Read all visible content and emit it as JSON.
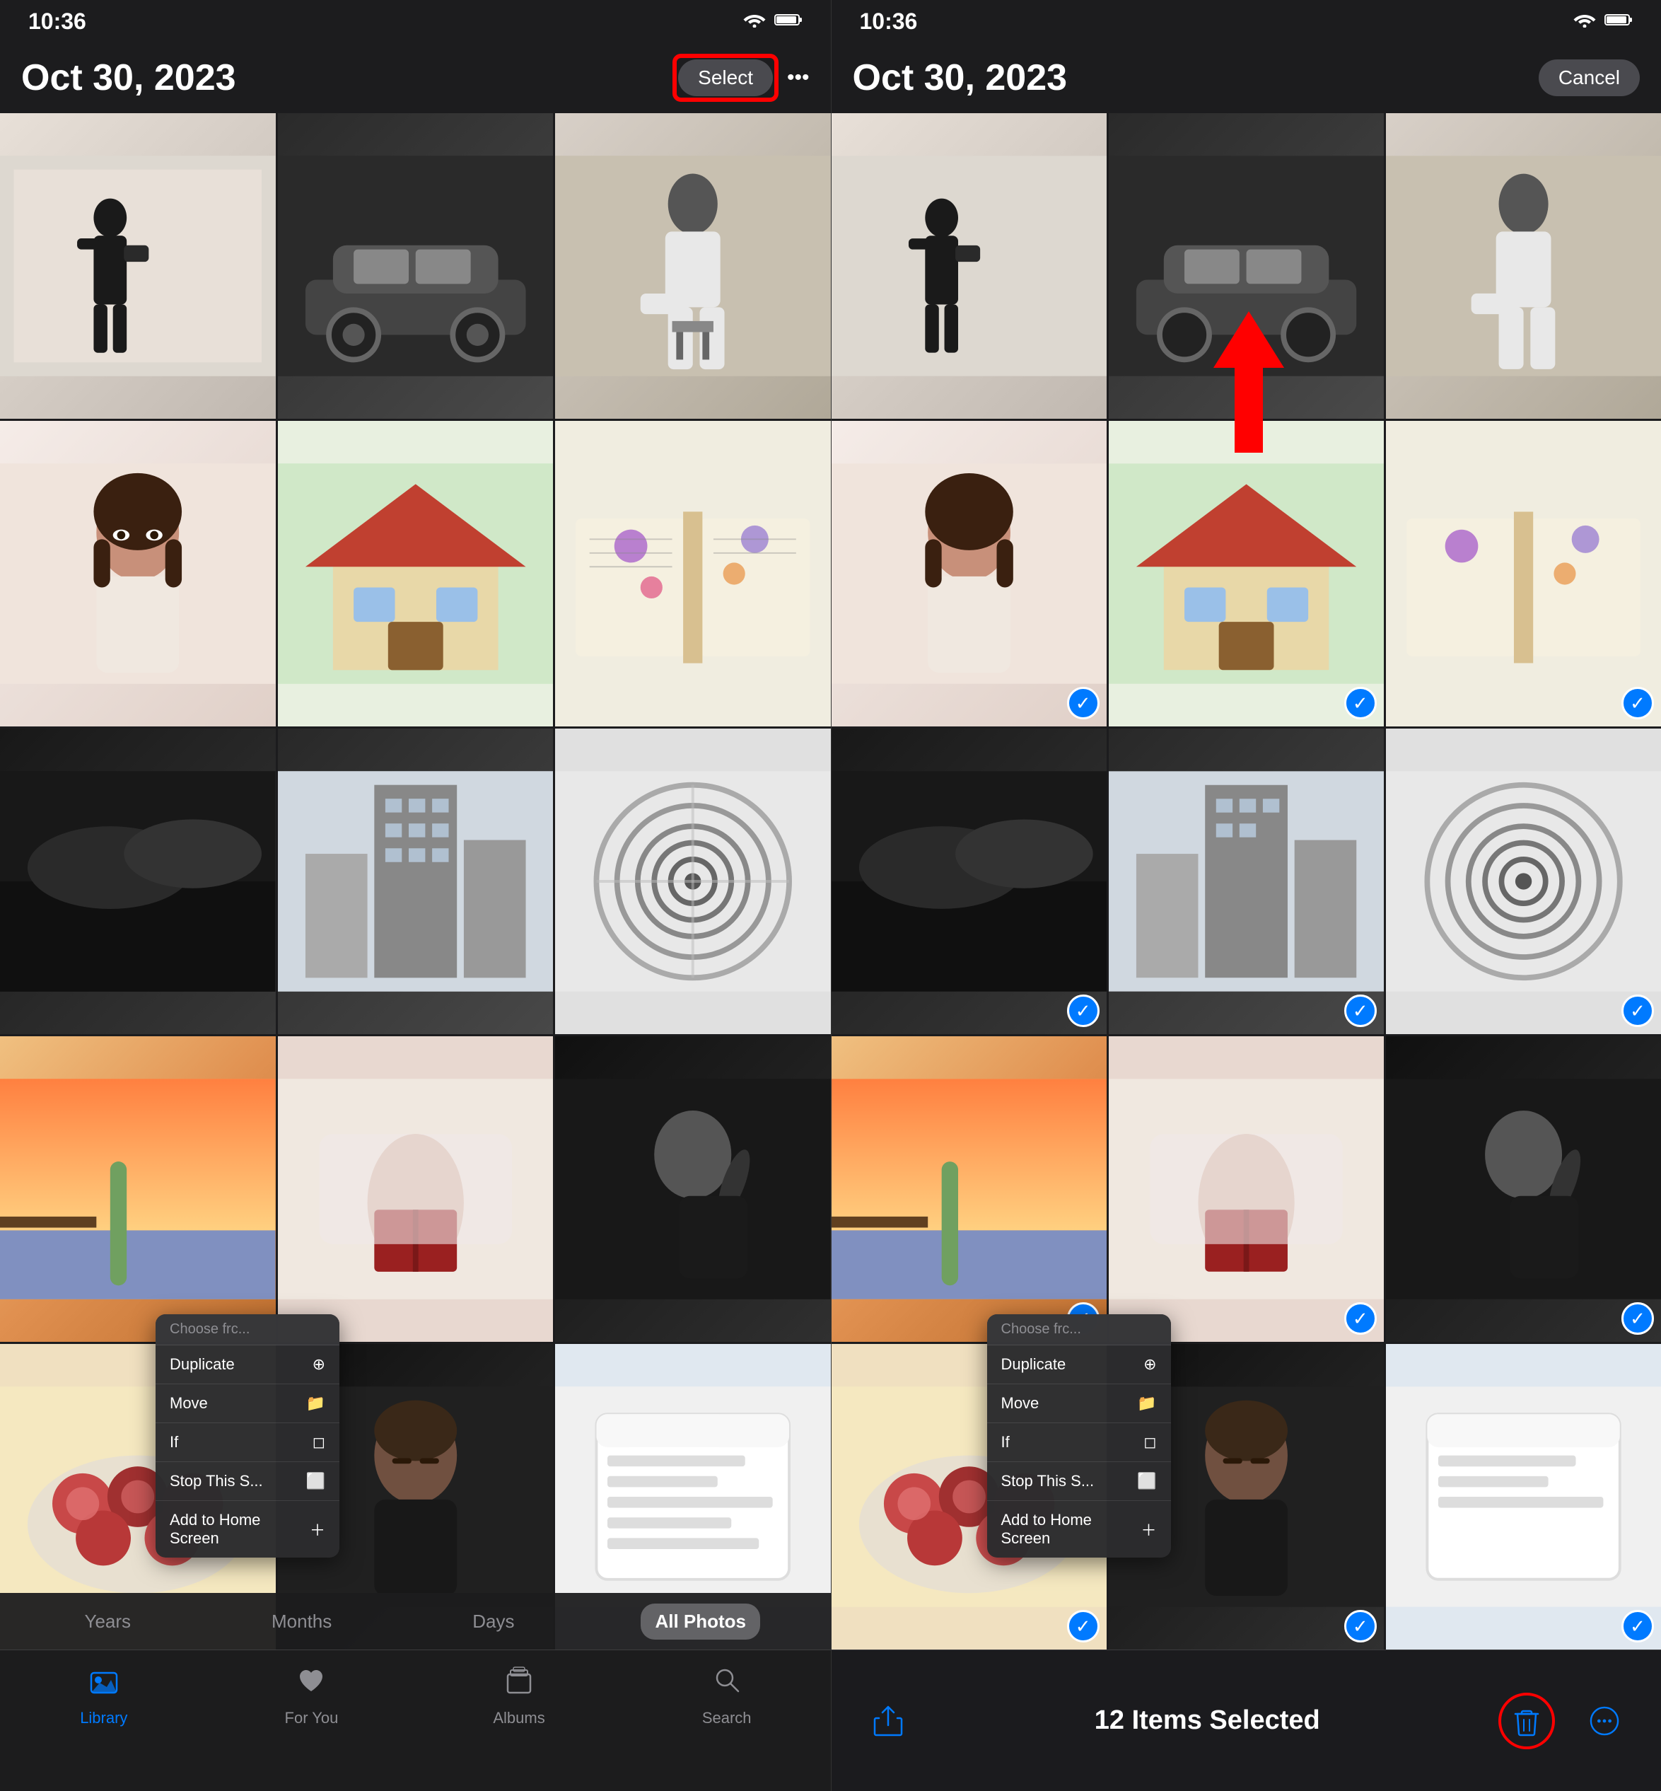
{
  "left_panel": {
    "status": {
      "time": "10:36",
      "wifi": "📶",
      "battery": "🔋"
    },
    "header": {
      "date": "Oct 30, 2023",
      "select_label": "Select",
      "more_label": "•••"
    },
    "photos": [
      {
        "id": 1,
        "class": "p1",
        "label": "man-silhouette"
      },
      {
        "id": 2,
        "class": "p2",
        "label": "vintage-car"
      },
      {
        "id": 3,
        "class": "p3",
        "label": "woman-sitting"
      },
      {
        "id": 4,
        "class": "p4",
        "label": "girl-portrait"
      },
      {
        "id": 5,
        "class": "p11",
        "label": "house-building"
      },
      {
        "id": 6,
        "class": "p6",
        "label": "flower-book"
      },
      {
        "id": 7,
        "class": "p7",
        "label": "dark-landscape"
      },
      {
        "id": 8,
        "class": "p12",
        "label": "skyscraper"
      },
      {
        "id": 9,
        "class": "p9",
        "label": "spiral-stairs"
      },
      {
        "id": 10,
        "class": "p10",
        "label": "sunset-surfboard"
      },
      {
        "id": 11,
        "class": "p3",
        "label": "book-hands"
      },
      {
        "id": 12,
        "class": "p15",
        "label": "woman-profile"
      },
      {
        "id": 13,
        "class": "p14",
        "label": "figs-food"
      },
      {
        "id": 14,
        "class": "p15",
        "label": "man-portrait"
      },
      {
        "id": 15,
        "class": "p7",
        "label": "screenshot-app"
      }
    ],
    "context_menu": {
      "header": "Choose frc...",
      "items": [
        "Duplicate",
        "Move",
        "Add to Home Screen"
      ],
      "shortcuts": [
        "⊕",
        "⊡",
        "⊞"
      ],
      "sub_items": [
        "If",
        "Stop This S..."
      ]
    },
    "timeline_tabs": [
      "Years",
      "Months",
      "Days",
      "All Photos"
    ],
    "active_tab": "All Photos",
    "bottom_tabs": [
      {
        "label": "Library",
        "icon": "📷",
        "active": true
      },
      {
        "label": "For You",
        "icon": "❤️",
        "active": false
      },
      {
        "label": "Albums",
        "icon": "📁",
        "active": false
      },
      {
        "label": "Search",
        "icon": "🔍",
        "active": false
      }
    ],
    "red_box": true
  },
  "right_panel": {
    "status": {
      "time": "10:36",
      "wifi": "📶",
      "battery": "🔋"
    },
    "header": {
      "date": "Oct 30, 2023",
      "cancel_label": "Cancel"
    },
    "selected_count": 12,
    "photos_selected": [
      1,
      2,
      3,
      4,
      5,
      6,
      7,
      8,
      9,
      10,
      11,
      12
    ],
    "action_bar": {
      "items_selected": "12 Items Selected",
      "share_icon": "share",
      "delete_icon": "trash",
      "more_icon": "ellipsis"
    },
    "context_menu": {
      "header": "Choose frc...",
      "items": [
        "Duplicate",
        "Move",
        "Add to Home Screen"
      ],
      "sub_items": [
        "If",
        "Stop This S..."
      ]
    },
    "red_arrow": true
  }
}
